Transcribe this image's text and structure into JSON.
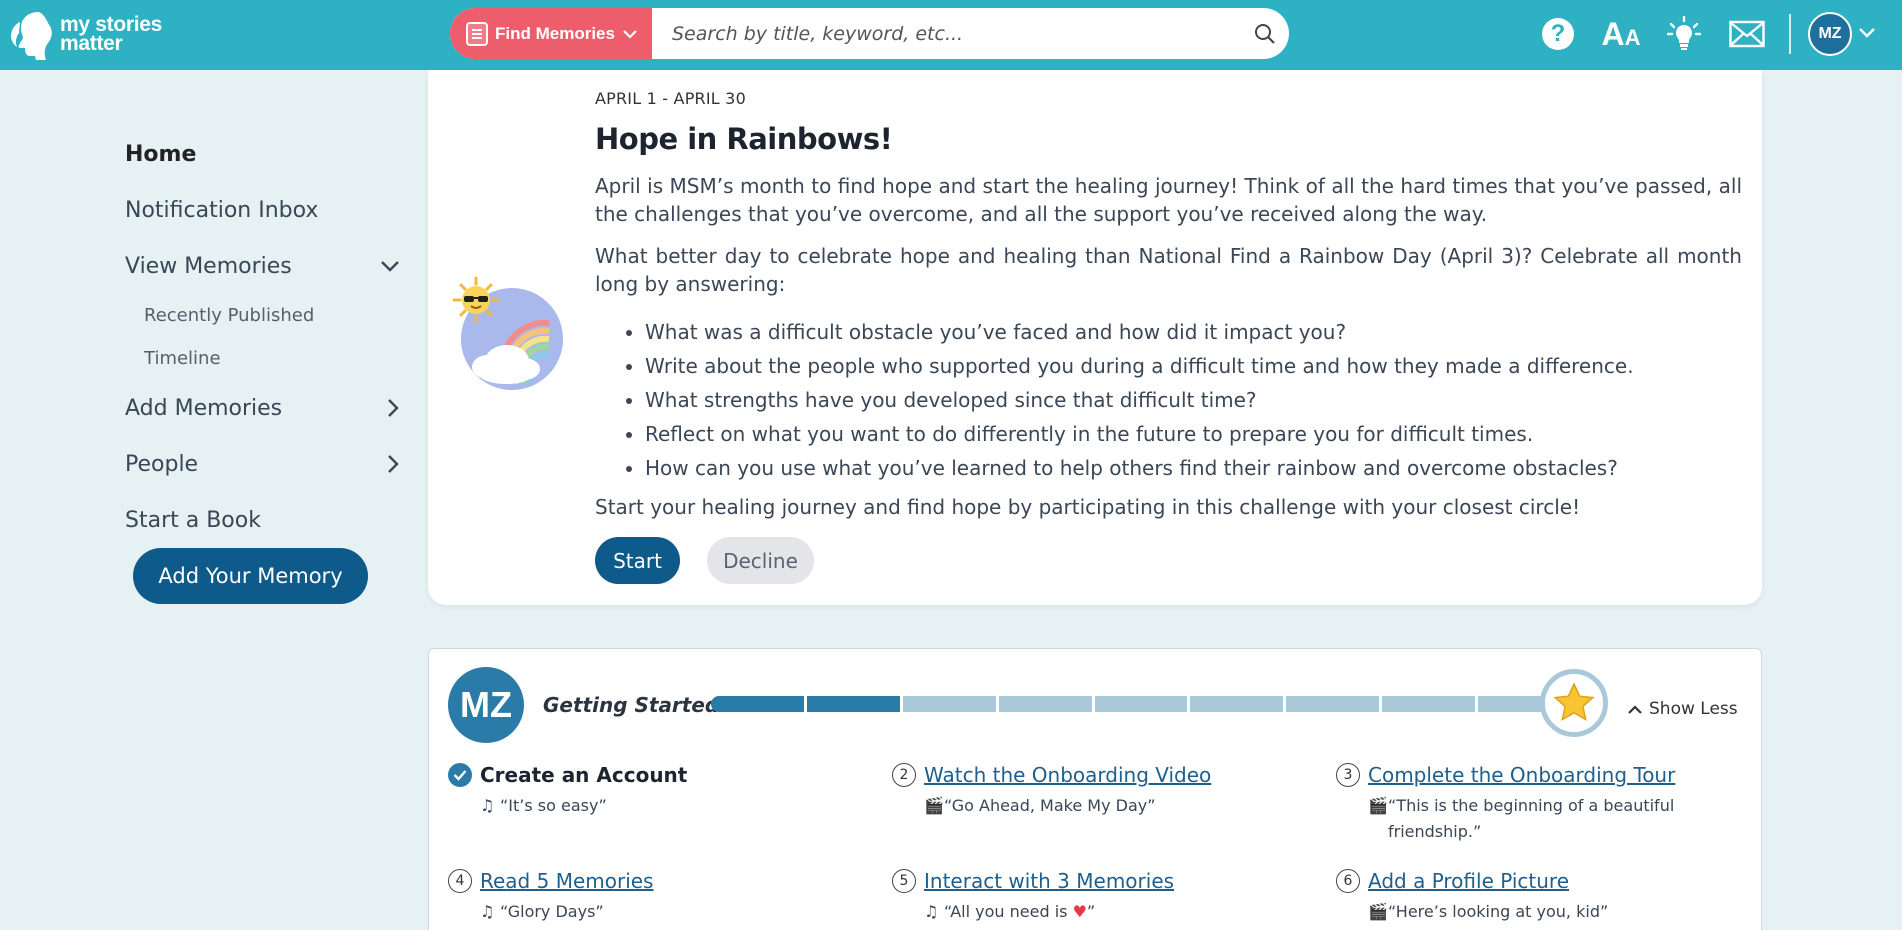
{
  "header": {
    "logo_line1": "my stories",
    "logo_line2": "matter",
    "find_button_label": "Find Memories",
    "search_placeholder": "Search by title, keyword, etc...",
    "brand_color": "#2fb1c4",
    "find_color": "#ee5d6c",
    "icons": [
      "help-icon",
      "text-size-icon",
      "lightbulb-icon",
      "mail-icon"
    ],
    "avatar_initials": "MZ"
  },
  "sidebar": {
    "home": "Home",
    "notifications": "Notification Inbox",
    "view_memories": "View Memories",
    "recently_published": "Recently Published",
    "timeline": "Timeline",
    "add_memories": "Add Memories",
    "people": "People",
    "start_book": "Start a Book",
    "add_memory_button": "Add Your Memory"
  },
  "challenge": {
    "date_range": "APRIL 1 - APRIL 30",
    "title": "Hope in Rainbows!",
    "para1": "April is MSM’s month to find hope and start the healing journey! Think of all the hard times that you’ve passed, all the challenges that you’ve overcome, and all the support you’ve received along the way.",
    "para2": "What better day to celebrate hope and healing than National Find a Rainbow Day (April 3)? Celebrate all month long by answering:",
    "questions": [
      "What was a difficult obstacle you’ve faced and how did it impact you?",
      "Write about the people who supported you during a difficult time and how they made a difference.",
      "What strengths have you developed since that difficult time?",
      "Reflect on what you want to do differently in the future to prepare you for difficult times.",
      "How can you use what you’ve learned to help others find their rainbow and overcome obstacles?"
    ],
    "closing": "Start your healing journey and find hope by participating in this challenge with your closest circle!",
    "start_label": "Start",
    "decline_label": "Decline"
  },
  "getting_started": {
    "avatar_initials": "MZ",
    "title": "Getting Started",
    "progress": {
      "completed": 2,
      "total": 9
    },
    "show_less": "Show Less",
    "steps": [
      {
        "num": "1",
        "title": "Create an Account",
        "quote": "“It’s so easy”",
        "icon": "music-note-icon",
        "done": true
      },
      {
        "num": "2",
        "title": "Watch the Onboarding Video",
        "quote": "“Go Ahead, Make My Day”",
        "icon": "clapper-icon",
        "done": false
      },
      {
        "num": "3",
        "title": "Complete the Onboarding Tour",
        "quote": "“This is the beginning of a beautiful friendship.”",
        "icon": "clapper-icon",
        "done": false
      },
      {
        "num": "4",
        "title": "Read 5 Memories",
        "quote": "“Glory Days”",
        "icon": "music-note-icon",
        "done": false
      },
      {
        "num": "5",
        "title": "Interact with 3 Memories",
        "quote": "“All you need is ",
        "icon": "music-note-icon",
        "done": false,
        "quote_suffix": "”"
      },
      {
        "num": "6",
        "title": "Add a Profile Picture",
        "quote": "“Here’s looking at you, kid”",
        "icon": "clapper-icon",
        "done": false
      }
    ]
  }
}
